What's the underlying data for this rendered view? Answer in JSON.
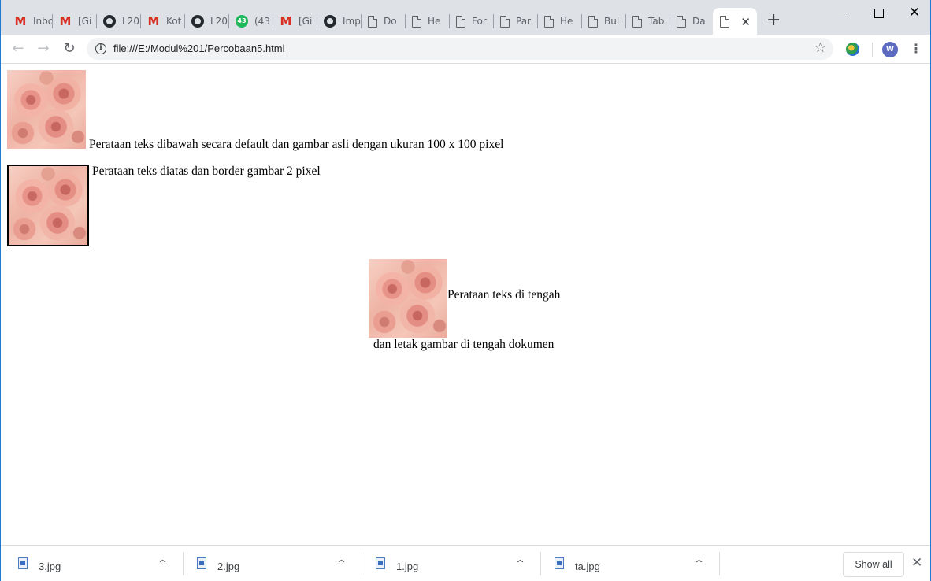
{
  "browser": {
    "tabs": [
      {
        "title": "Inbox",
        "icon": "gmail-icon"
      },
      {
        "title": "[Gi",
        "icon": "gmail-icon"
      },
      {
        "title": "L20",
        "icon": "github-icon"
      },
      {
        "title": "Kot",
        "icon": "gmail-icon"
      },
      {
        "title": "L20",
        "icon": "github-icon"
      },
      {
        "title": "(43",
        "icon": "whatsapp-icon",
        "badge": "43"
      },
      {
        "title": "[Gi",
        "icon": "gmail-icon"
      },
      {
        "title": "Imp",
        "icon": "github-icon"
      },
      {
        "title": "Do",
        "icon": "document-icon"
      },
      {
        "title": "He",
        "icon": "document-icon"
      },
      {
        "title": "For",
        "icon": "document-icon"
      },
      {
        "title": "Par",
        "icon": "document-icon"
      },
      {
        "title": "He",
        "icon": "document-icon"
      },
      {
        "title": "Bul",
        "icon": "document-icon"
      },
      {
        "title": "Tab",
        "icon": "document-icon"
      },
      {
        "title": "Da",
        "icon": "document-icon"
      },
      {
        "title": "",
        "icon": "document-icon",
        "active": true
      }
    ],
    "new_tab_label": "+",
    "address_bar": {
      "url": "file:///E:/Modul%201/Percobaan5.html"
    },
    "profile_initial": "W"
  },
  "page": {
    "text1": "Perataan teks dibawah secara default dan gambar asli dengan ukuran 100 x 100 pixel",
    "text2": "Perataan teks diatas dan border gambar 2 pixel",
    "text3": "Perataan teks di tengah",
    "text4": "dan letak gambar di tengah dokumen"
  },
  "downloads": {
    "items": [
      {
        "name": "3.jpg"
      },
      {
        "name": "2.jpg"
      },
      {
        "name": "1.jpg"
      },
      {
        "name": "ta.jpg"
      }
    ],
    "show_all_label": "Show all"
  },
  "colors": {
    "tabstrip_bg": "#dee1e6",
    "window_border": "#1f7ad3",
    "gmail_red": "#d93025",
    "avatar_bg": "#5c6bc0"
  }
}
